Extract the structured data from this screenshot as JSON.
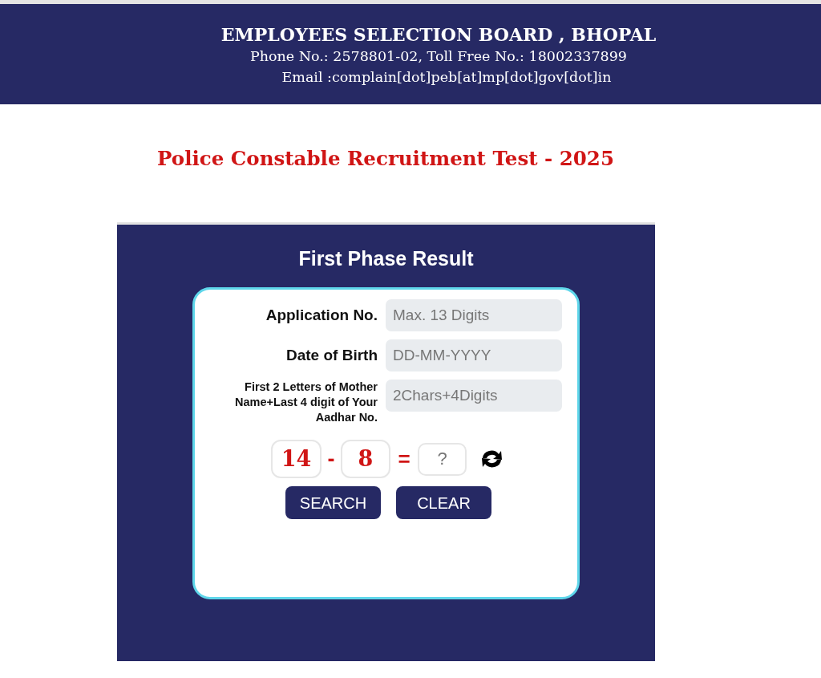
{
  "header": {
    "title": "EMPLOYEES SELECTION BOARD , BHOPAL",
    "phone": "Phone No.: 2578801-02, Toll Free No.: 18002337899",
    "email": "Email :complain[dot]peb[at]mp[dot]gov[dot]in"
  },
  "page_title": "Police Constable Recruitment Test - 2025",
  "panel": {
    "title": "First Phase Result",
    "fields": [
      {
        "kind": "plain",
        "label": "Application No.",
        "placeholder": "Max. 13 Digits"
      },
      {
        "kind": "plain",
        "label": "Date of Birth",
        "placeholder": "DD-MM-YYYY"
      },
      {
        "kind": "compact",
        "label": "First 2 Letters of Mother Name+Last 4 digit of Your Aadhar No.",
        "placeholder": "2Chars+4Digits"
      }
    ],
    "captcha": {
      "operand_1": "14",
      "operator": "-",
      "operand_2": "8",
      "equals": "=",
      "answer": {
        "placeholder": "?"
      }
    },
    "buttons": [
      "SEARCH",
      "CLEAR"
    ]
  }
}
